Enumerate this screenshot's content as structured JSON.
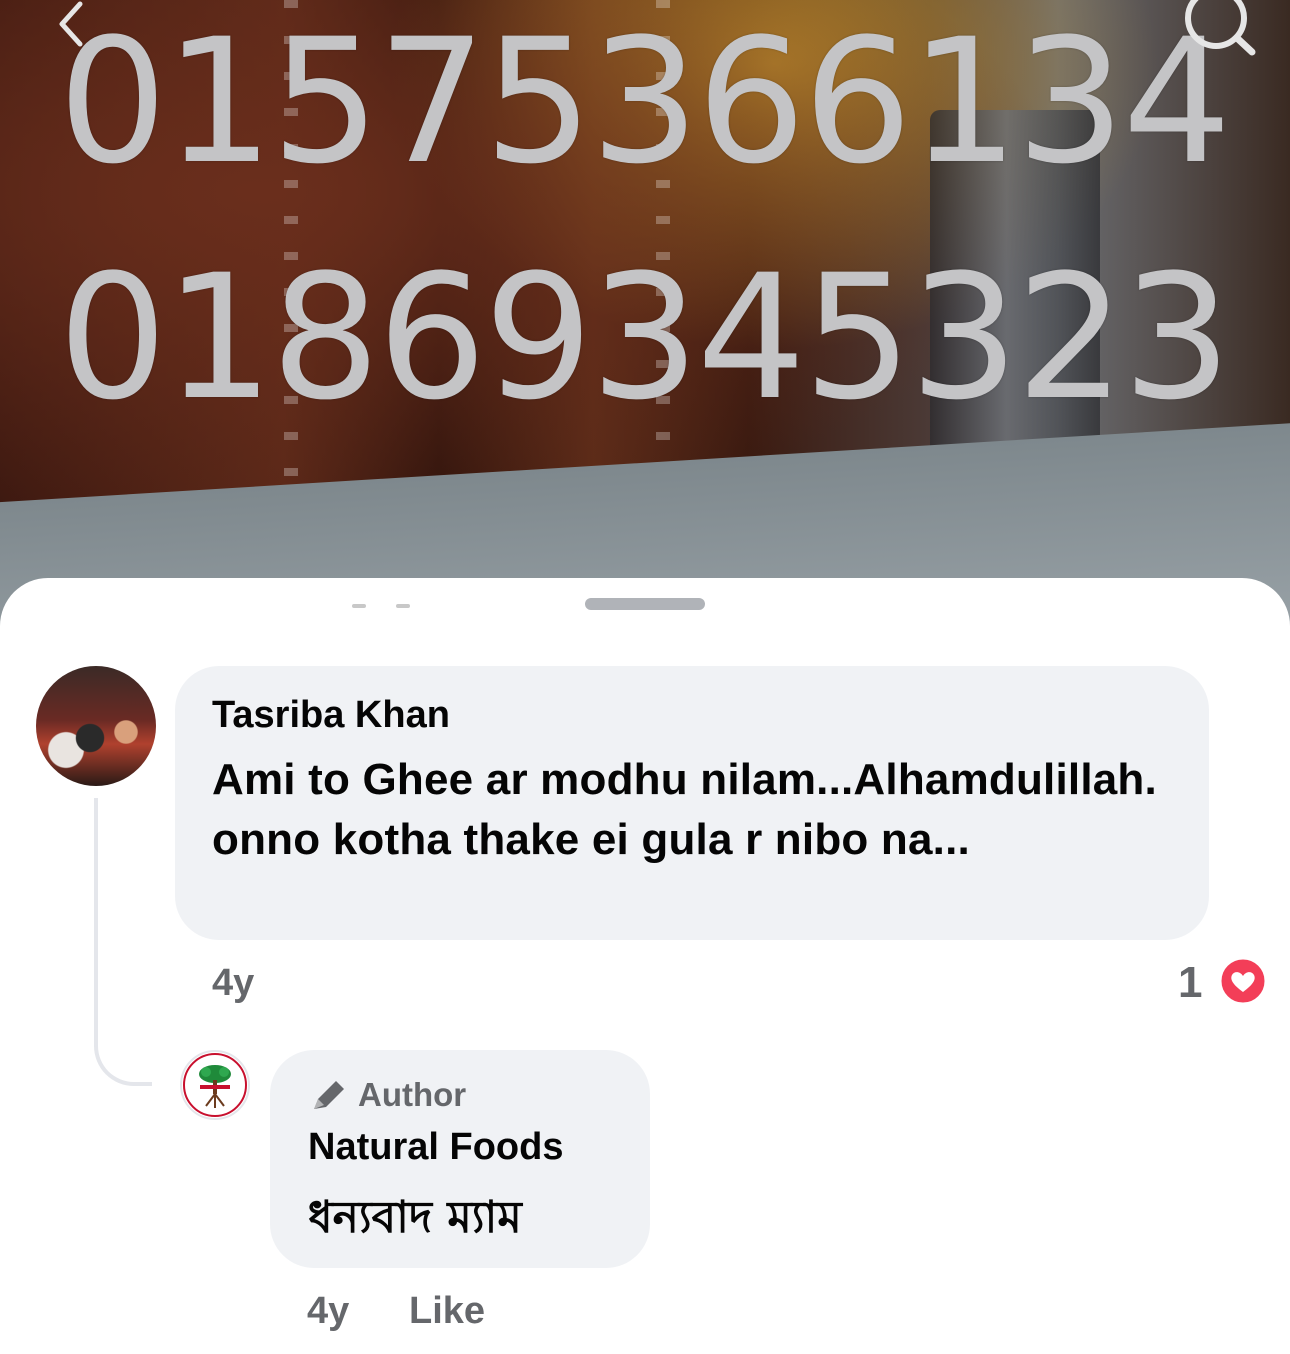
{
  "video": {
    "phone_line_1": "01575366134",
    "phone_line_2": "01869345323"
  },
  "icons": {
    "back": "chevron-left-icon",
    "search": "search-icon",
    "author": "pencil-icon",
    "reaction": "heart-icon"
  },
  "comment": {
    "author_name": "Tasriba Khan",
    "text": "Ami to Ghee ar modhu nilam...Alhamdulillah. onno kotha thake ei gula r nibo na...",
    "time": "4y",
    "reaction_count": "1"
  },
  "reply": {
    "badge_label": "Author",
    "author_name": "Natural Foods",
    "text": "ধন্যবাদ ম্যাম",
    "time": "4y",
    "like_label": "Like"
  },
  "colors": {
    "bubble_bg": "#f0f2f5",
    "secondary_text": "#65676b",
    "heart_red": "#f33e58"
  }
}
